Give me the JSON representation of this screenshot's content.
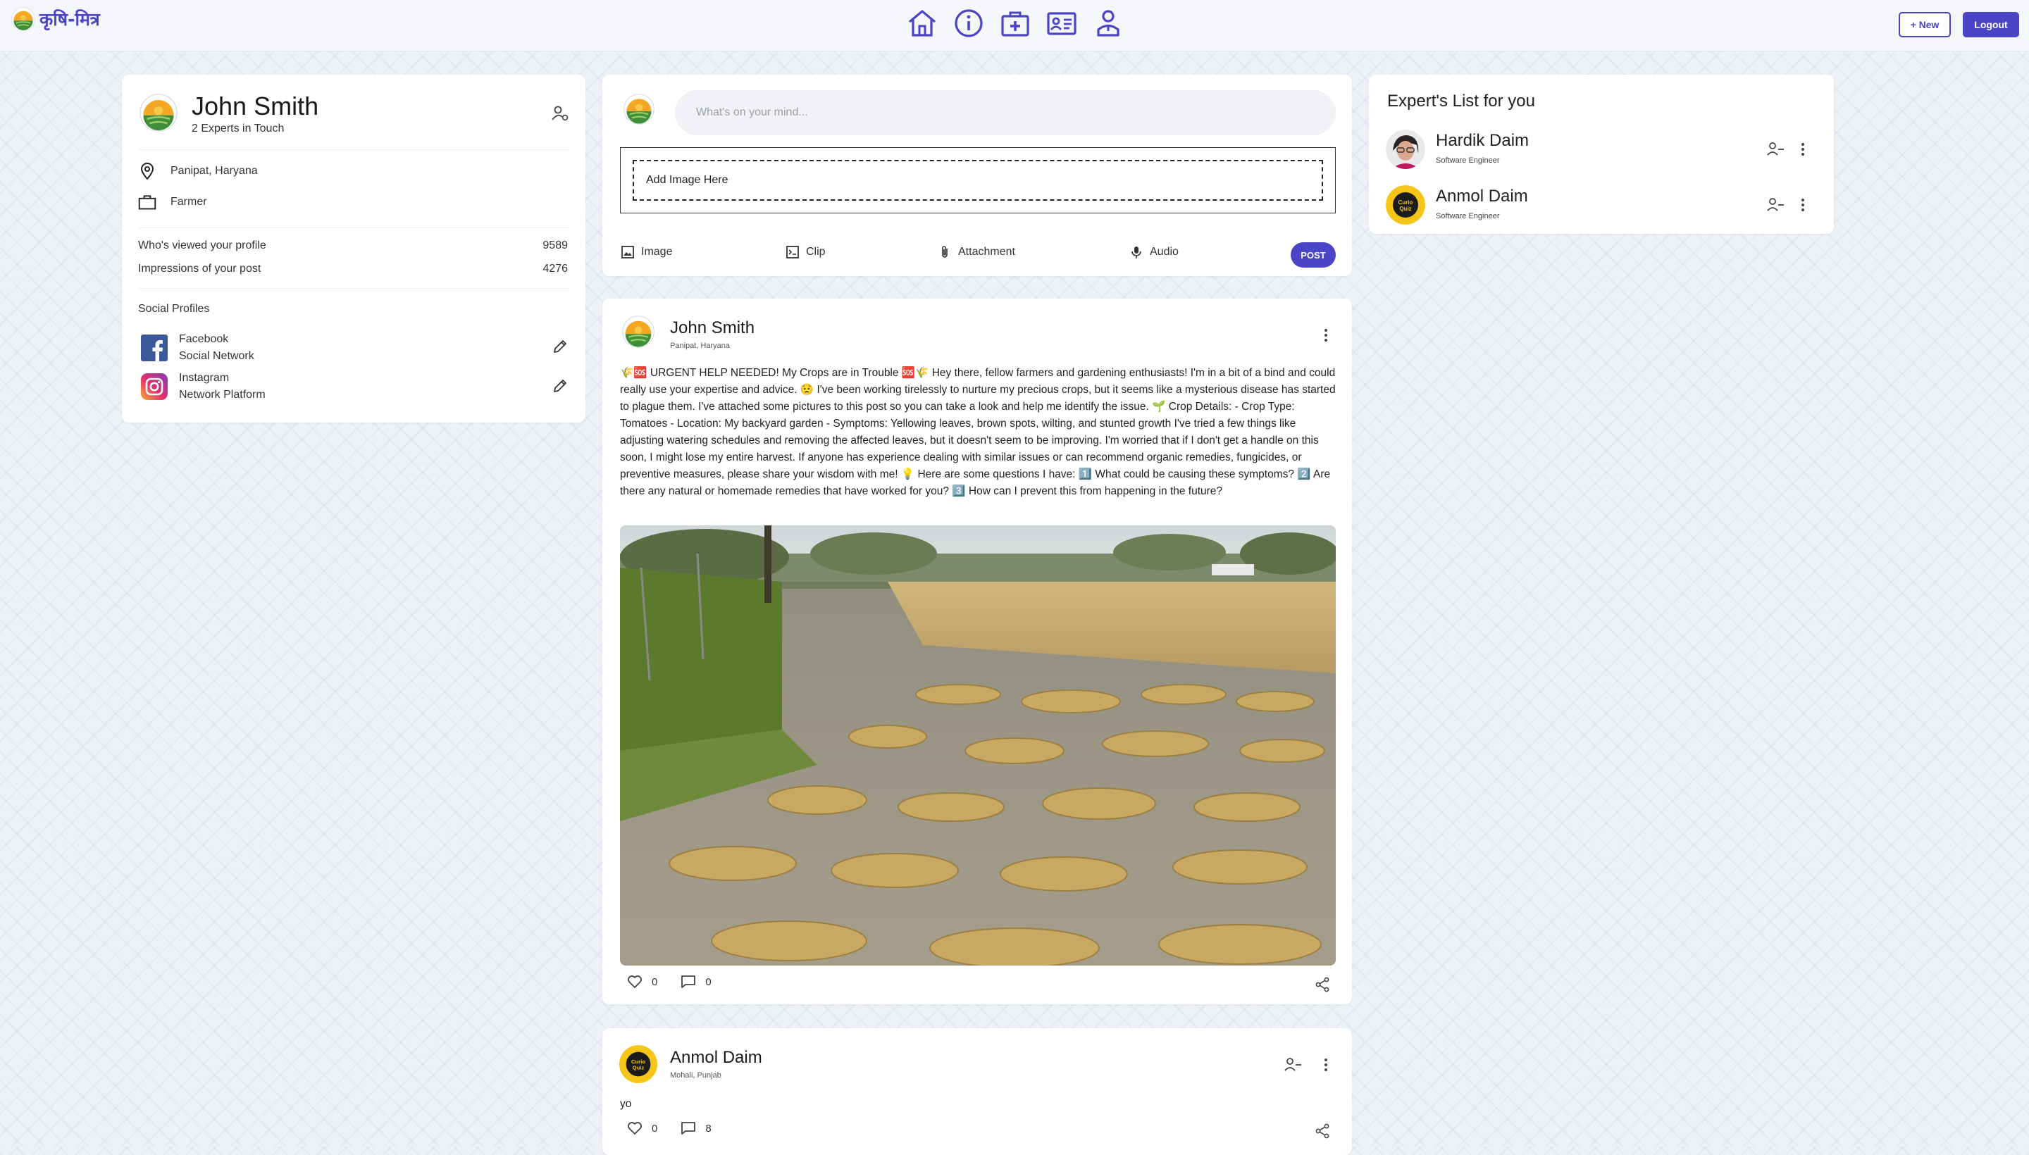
{
  "colors": {
    "accent": "#4a44c6",
    "background": "#eef1f6",
    "card": "#ffffff"
  },
  "header": {
    "logo_text": "कृषि-मित्र",
    "nav_icons": [
      "home-icon",
      "info-icon",
      "medical-kit-icon",
      "id-card-icon",
      "expert-user-icon"
    ],
    "new_label": "+ New",
    "logout_label": "Logout"
  },
  "profile": {
    "name": "John Smith",
    "experts_in_touch": "2 Experts in Touch",
    "location": "Panipat, Haryana",
    "occupation": "Farmer",
    "stats": [
      {
        "label": "Who's viewed your profile",
        "value": "9589"
      },
      {
        "label": "Impressions of your post",
        "value": "4276"
      }
    ],
    "social_heading": "Social Profiles",
    "social": [
      {
        "name": "Facebook",
        "type": "Social Network",
        "icon": "facebook-icon"
      },
      {
        "name": "Instagram",
        "type": "Network Platform",
        "icon": "instagram-icon"
      }
    ]
  },
  "composer": {
    "placeholder": "What's on your mind...",
    "drop_label": "Add Image Here",
    "actions": [
      "Image",
      "Clip",
      "Attachment",
      "Audio"
    ],
    "post_label": "POST"
  },
  "posts": [
    {
      "author": "John Smith",
      "location": "Panipat, Haryana",
      "text": "🌾🆘 URGENT HELP NEEDED! My Crops are in Trouble 🆘🌾 Hey there, fellow farmers and gardening enthusiasts! I'm in a bit of a bind and could really use your expertise and advice. 😟 I've been working tirelessly to nurture my precious crops, but it seems like a mysterious disease has started to plague them. I've attached some pictures to this post so you can take a look and help me identify the issue. 🌱 Crop Details: - Crop Type: Tomatoes - Location: My backyard garden - Symptoms: Yellowing leaves, brown spots, wilting, and stunted growth I've tried a few things like adjusting watering schedules and removing the affected leaves, but it doesn't seem to be improving. I'm worried that if I don't get a handle on this soon, I might lose my entire harvest. If anyone has experience dealing with similar issues or can recommend organic remedies, fungicides, or preventive measures, please share your wisdom with me! 💡 Here are some questions I have: 1️⃣ What could be causing these symptoms? 2️⃣ Are there any natural or homemade remedies that have worked for you? 3️⃣ How can I prevent this from happening in the future?",
      "likes": "0",
      "comments": "0"
    },
    {
      "author": "Anmol Daim",
      "location": "Mohali, Punjab",
      "text": "yo",
      "likes": "0",
      "comments": "8"
    }
  ],
  "experts": {
    "title": "Expert's List for you",
    "list": [
      {
        "name": "Hardik Daim",
        "role": "Software Engineer"
      },
      {
        "name": "Anmol Daim",
        "role": "Software Engineer",
        "avatar_text": "Curio Quiz"
      }
    ]
  }
}
